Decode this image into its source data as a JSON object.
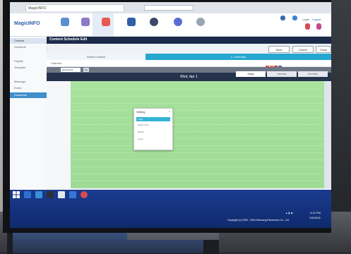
{
  "browser": {
    "tab_title": "MagicINFO",
    "address": ""
  },
  "header": {
    "logo": "MagicINFO",
    "nav": [
      "",
      "",
      "",
      "",
      "",
      "",
      ""
    ],
    "login": "Login",
    "logout": "Logout"
  },
  "sidebar": {
    "items": [
      "Content",
      "Schedule",
      "",
      "Playlist",
      "Template",
      "",
      "Message",
      "Event",
      "Download"
    ]
  },
  "title_bar": {
    "title": "Content Schedule Edit",
    "sub": ""
  },
  "buttons": {
    "save": "Save",
    "cancel": "Cancel",
    "close": "Close"
  },
  "tabs": {
    "tab1": "Select Content",
    "tab2": "2. Schedule"
  },
  "toolbar": {
    "label": "Channel"
  },
  "calendar": {
    "date": "2016-04-01",
    "go": "Go",
    "day_label": "Wed, Apr 1",
    "views": [
      "Daily",
      "Weekly",
      "Monthly"
    ],
    "times": [
      "",
      "",
      "",
      "",
      "",
      "",
      "",
      "",
      "",
      "",
      "",
      "",
      "",
      ""
    ]
  },
  "popup": {
    "title": "Setting",
    "close": "x",
    "items": [
      "Apply",
      "Select Time",
      "Delete",
      "Close"
    ]
  },
  "status_text": "",
  "copyright": "Copyright (c) 2009 - 2016 Samsung Electronics Co., Ltd.",
  "clock": {
    "time": "4:12 PM",
    "date": "1/5/2016"
  },
  "colors": {
    "accent": "#26a7cf",
    "schedule_fill": "#a8e29c",
    "title_bar": "#1c2a4a",
    "taskbar": "#1a3b8f"
  }
}
